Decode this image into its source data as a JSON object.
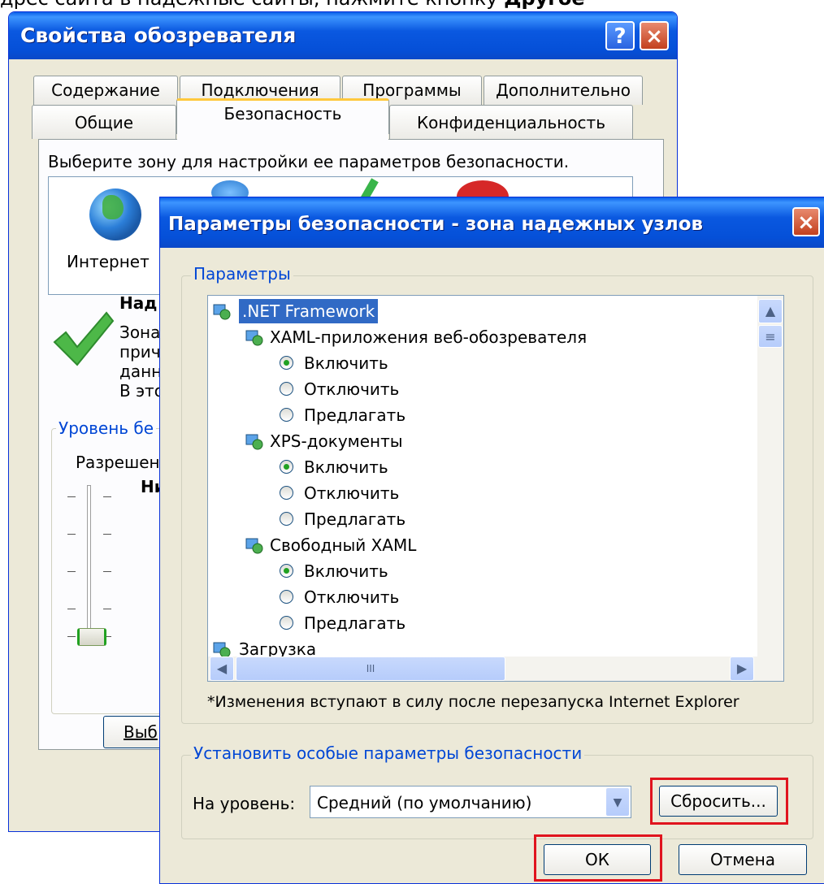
{
  "top_text": {
    "text": "дрес сайта в надёжные сайты, нажмите кнопку",
    "bold": "Другое"
  },
  "background_dialog": {
    "title": "Свойства обозревателя",
    "help_glyph": "?",
    "close_glyph": "×",
    "tabs_top": [
      "Содержание",
      "Подключения",
      "Программы",
      "Дополнительно"
    ],
    "tabs_bottom": [
      "Общие",
      "Безопасность",
      "Конфиденциальность"
    ],
    "zone_prompt": "Выберите зону для настройки ее параметров безопасности.",
    "zones": [
      "Интернет"
    ],
    "zone_title_partial": "Над",
    "zone_desc_partial": [
      "Зона",
      "прич",
      "данн",
      "В это"
    ],
    "level_group_partial": "Уровень бе",
    "allowed_partial": "Разрешен",
    "level_partial": "Ни",
    "button_partial": "Выб"
  },
  "front_dialog": {
    "title": "Параметры безопасности - зона надежных узлов",
    "close_glyph": "×",
    "params_group": "Параметры",
    "tree": [
      {
        "type": "node",
        "level": 0,
        "label": ".NET Framework",
        "selected": true
      },
      {
        "type": "node",
        "level": 1,
        "label": "XAML-приложения веб-обозревателя"
      },
      {
        "type": "radio",
        "level": 2,
        "label": "Включить",
        "checked": true
      },
      {
        "type": "radio",
        "level": 2,
        "label": "Отключить",
        "checked": false
      },
      {
        "type": "radio",
        "level": 2,
        "label": "Предлагать",
        "checked": false
      },
      {
        "type": "node",
        "level": 1,
        "label": "XPS-документы"
      },
      {
        "type": "radio",
        "level": 2,
        "label": "Включить",
        "checked": true
      },
      {
        "type": "radio",
        "level": 2,
        "label": "Отключить",
        "checked": false
      },
      {
        "type": "radio",
        "level": 2,
        "label": "Предлагать",
        "checked": false
      },
      {
        "type": "node",
        "level": 1,
        "label": "Свободный XAML"
      },
      {
        "type": "radio",
        "level": 2,
        "label": "Включить",
        "checked": true
      },
      {
        "type": "radio",
        "level": 2,
        "label": "Отключить",
        "checked": false
      },
      {
        "type": "radio",
        "level": 2,
        "label": "Предлагать",
        "checked": false
      },
      {
        "type": "node",
        "level": 0,
        "label": "Загрузка"
      }
    ],
    "note": "*Изменения вступают в силу после перезапуска Internet Explorer",
    "custom_group": "Установить особые параметры безопасности",
    "level_label": "На уровень:",
    "level_value": "Средний (по умолчанию)",
    "reset_button": "Сбросить...",
    "ok_button": "ОК",
    "cancel_button": "Отмена",
    "scroll_grip": "III",
    "colors": {
      "highlight_box": "#E0141E",
      "title_bar": "#0A58E0",
      "accent_text": "#0046D5"
    }
  }
}
